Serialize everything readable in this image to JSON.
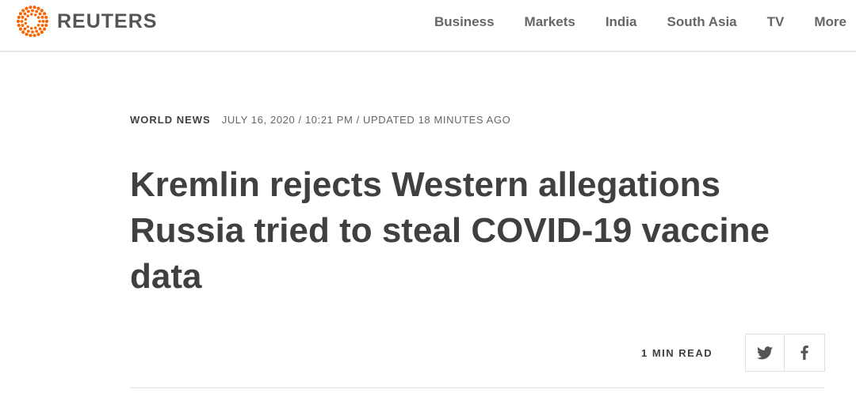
{
  "brand": {
    "name": "REUTERS",
    "accent": "#fa6400"
  },
  "nav": {
    "items": [
      {
        "label": "Business"
      },
      {
        "label": "Markets"
      },
      {
        "label": "India"
      },
      {
        "label": "South Asia"
      },
      {
        "label": "TV"
      },
      {
        "label": "More"
      }
    ]
  },
  "article": {
    "category": "WORLD NEWS",
    "dateline": "JULY 16, 2020 / 10:21 PM / UPDATED 18 MINUTES AGO",
    "headline": "Kremlin rejects Western allegations Russia tried to steal COVID-19 vaccine data",
    "read_time": "1 MIN READ"
  },
  "share": {
    "buttons": [
      {
        "icon": "twitter-icon"
      },
      {
        "icon": "facebook-icon"
      }
    ]
  },
  "colors": {
    "text_dark": "#404040",
    "text_muted": "#666666",
    "divider": "#e6e6e6"
  }
}
